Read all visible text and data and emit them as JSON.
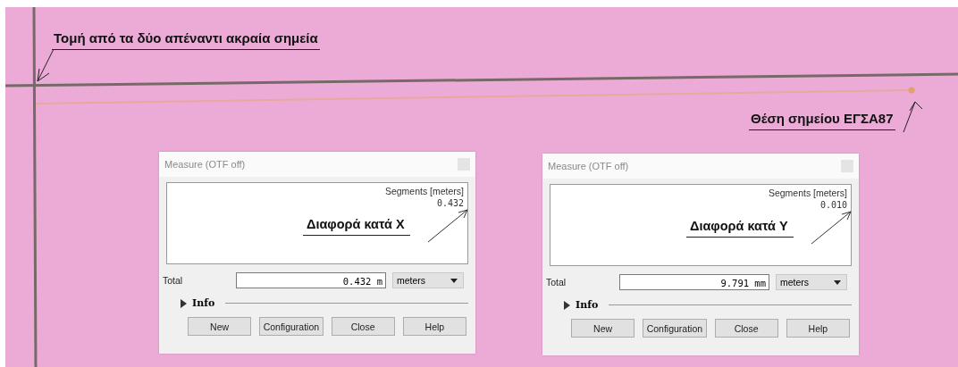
{
  "annotations": [
    {
      "text": "Τομή από τα δύο απέναντι ακραία σημεία"
    },
    {
      "text": "Θέση σημείου ΕΓΣΑ87"
    }
  ],
  "dialogs": [
    {
      "title": "Measure (OTF off)",
      "segments_header": "Segments [meters]",
      "segments": [
        "0.432"
      ],
      "note": "Διαφορά κατά X",
      "total_label": "Total",
      "total": "0.432 m",
      "units": "meters",
      "info": "Info",
      "buttons": [
        "New",
        "Configuration",
        "Close",
        "Help"
      ]
    },
    {
      "title": "Measure (OTF off)",
      "segments_header": "Segments [meters]",
      "segments": [
        "0.010"
      ],
      "note": "Διαφορά κατά Y",
      "total_label": "Total",
      "total": "9.791 mm",
      "units": "meters",
      "info": "Info",
      "buttons": [
        "New",
        "Configuration",
        "Close",
        "Help"
      ]
    }
  ]
}
